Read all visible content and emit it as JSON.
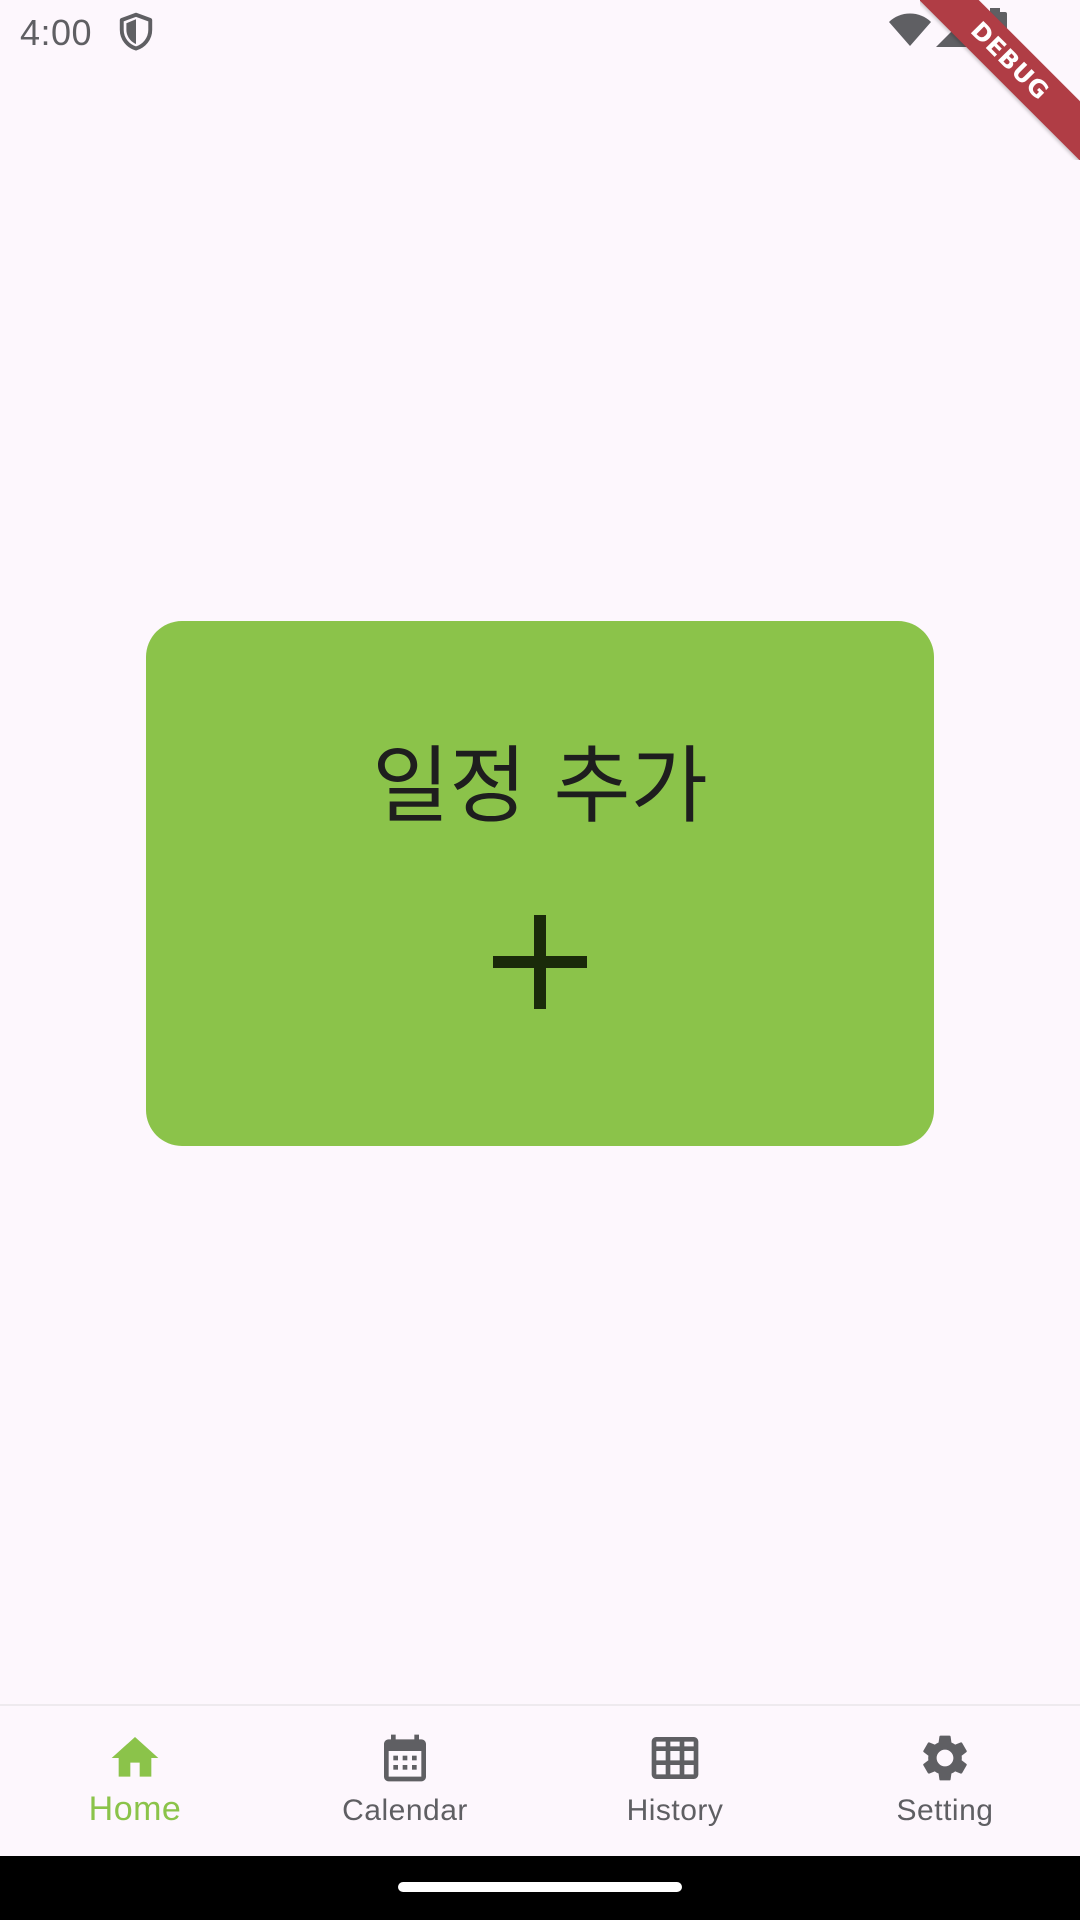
{
  "status_bar": {
    "time": "4:00",
    "icons": [
      "shield-icon",
      "wifi-icon",
      "signal-icon",
      "battery-icon"
    ]
  },
  "debug_banner": {
    "label": "DEBUG"
  },
  "main": {
    "add_schedule_card": {
      "title": "일정 추가",
      "icon": "plus-icon",
      "background_color": "#8bc34a"
    }
  },
  "bottom_nav": {
    "active_index": 0,
    "active_color": "#8bc34a",
    "inactive_color": "#5f5f63",
    "items": [
      {
        "label": "Home",
        "icon": "home-icon"
      },
      {
        "label": "Calendar",
        "icon": "calendar-icon"
      },
      {
        "label": "History",
        "icon": "grid-icon"
      },
      {
        "label": "Setting",
        "icon": "gear-icon"
      }
    ]
  },
  "theme": {
    "background": "#fdf7fd",
    "system_nav_background": "#000000"
  }
}
